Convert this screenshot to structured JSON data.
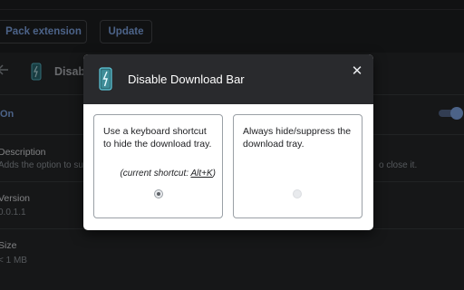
{
  "toolbar": {
    "pack_extension_label": "Pack extension",
    "update_label": "Update"
  },
  "background": {
    "extension_name": "Disable",
    "on_label": "On",
    "description_label": "Description",
    "description_value": "Adds the option to su",
    "description_tail": "o close it.",
    "version_label": "Version",
    "version_value": "0.0.1.1",
    "size_label": "Size",
    "size_value": "< 1 MB",
    "toggle_on": true
  },
  "dialog": {
    "title": "Disable Download Bar",
    "close_glyph": "✕",
    "option_shortcut": {
      "text": "Use a keyboard shortcut to hide the download tray.",
      "note_prefix": "(current shortcut: ",
      "note_key": "Alt+K",
      "note_suffix": ")",
      "selected": true
    },
    "option_always": {
      "text": "Always hide/suppress the download tray.",
      "selected": false
    }
  },
  "colors": {
    "accent": "#8ab4f8",
    "dialog_header": "#292a2d",
    "page_bg": "#202124",
    "icon_teal": "#5ec6d8"
  },
  "icons": {
    "back": "arrow-left-icon",
    "extension": "download-bar-extension-icon",
    "close": "close-icon"
  }
}
